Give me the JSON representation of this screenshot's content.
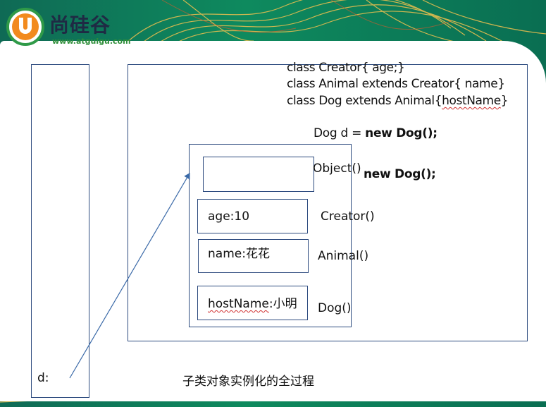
{
  "header": {
    "logo_text": "尚硅谷",
    "logo_url": "www.atguigu.com"
  },
  "code": {
    "line1": "class Creator{ age;}",
    "line2": "class Animal extends Creator{ name}",
    "line3_prefix": "class Dog extends Animal{",
    "line3_host": "hostName",
    "line3_suffix": "}",
    "statement_prefix": "Dog d = ",
    "statement_bold": "new Dog();"
  },
  "object_layers": {
    "object_label": "Object()",
    "new_dog_label": "new Dog();",
    "creator_label": "Creator()",
    "animal_label": "Animal()",
    "dog_label": "Dog()",
    "age_value": "age:10",
    "name_value": "name:花花",
    "hostname_field": "hostName",
    "hostname_value": ":小明"
  },
  "stack": {
    "var_label": "d:"
  },
  "caption": "子类对象实例化的全过程"
}
